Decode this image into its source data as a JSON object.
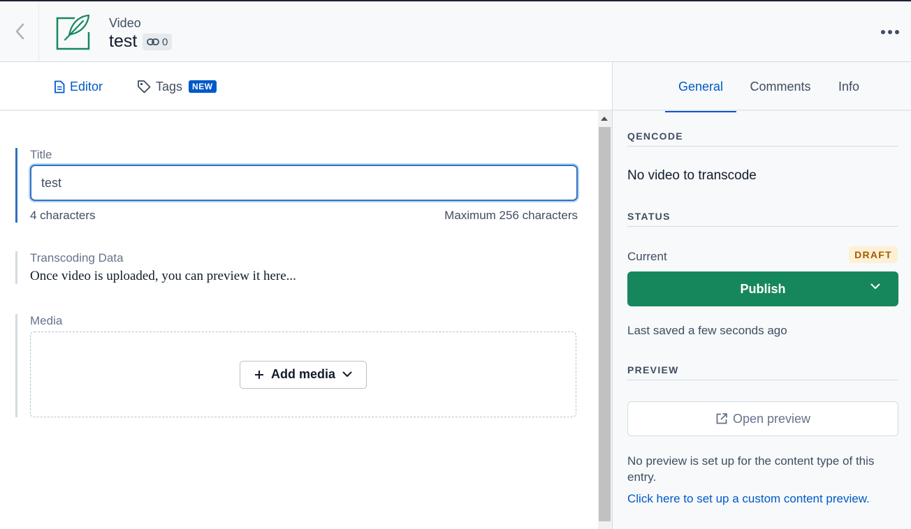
{
  "header": {
    "content_type": "Video",
    "entry_title": "test",
    "reference_count": "0"
  },
  "editor_tabs": [
    {
      "label": "Editor",
      "active": true
    },
    {
      "label": "Tags",
      "badge": "NEW",
      "active": false
    }
  ],
  "fields": {
    "title": {
      "label": "Title",
      "value": "test",
      "char_count": "4 characters",
      "max": "Maximum 256 characters"
    },
    "transcoding": {
      "label": "Transcoding Data",
      "text": "Once video is uploaded, you can preview it here..."
    },
    "media": {
      "label": "Media",
      "add_label": "Add media"
    }
  },
  "sidebar": {
    "tabs": [
      {
        "label": "General",
        "active": true
      },
      {
        "label": "Comments",
        "active": false
      },
      {
        "label": "Info",
        "active": false
      }
    ],
    "qencode": {
      "heading": "QENCODE",
      "text": "No video to transcode"
    },
    "status": {
      "heading": "STATUS",
      "current_label": "Current",
      "badge": "DRAFT",
      "publish_label": "Publish",
      "last_saved": "Last saved a few seconds ago"
    },
    "preview": {
      "heading": "PREVIEW",
      "open_label": "Open preview",
      "note": "No preview is set up for the content type of this entry.",
      "link": "Click here to set up a custom content preview."
    }
  },
  "colors": {
    "accent": "#0059c8",
    "publish": "#16875d",
    "draft_bg": "#fdf0d6",
    "draft_text": "#a35b00"
  },
  "icons": [
    "chevron-left-icon",
    "feather-icon",
    "link-icon",
    "more-icon",
    "document-icon",
    "tag-icon",
    "plus-icon",
    "chevron-down-icon",
    "external-link-icon"
  ]
}
